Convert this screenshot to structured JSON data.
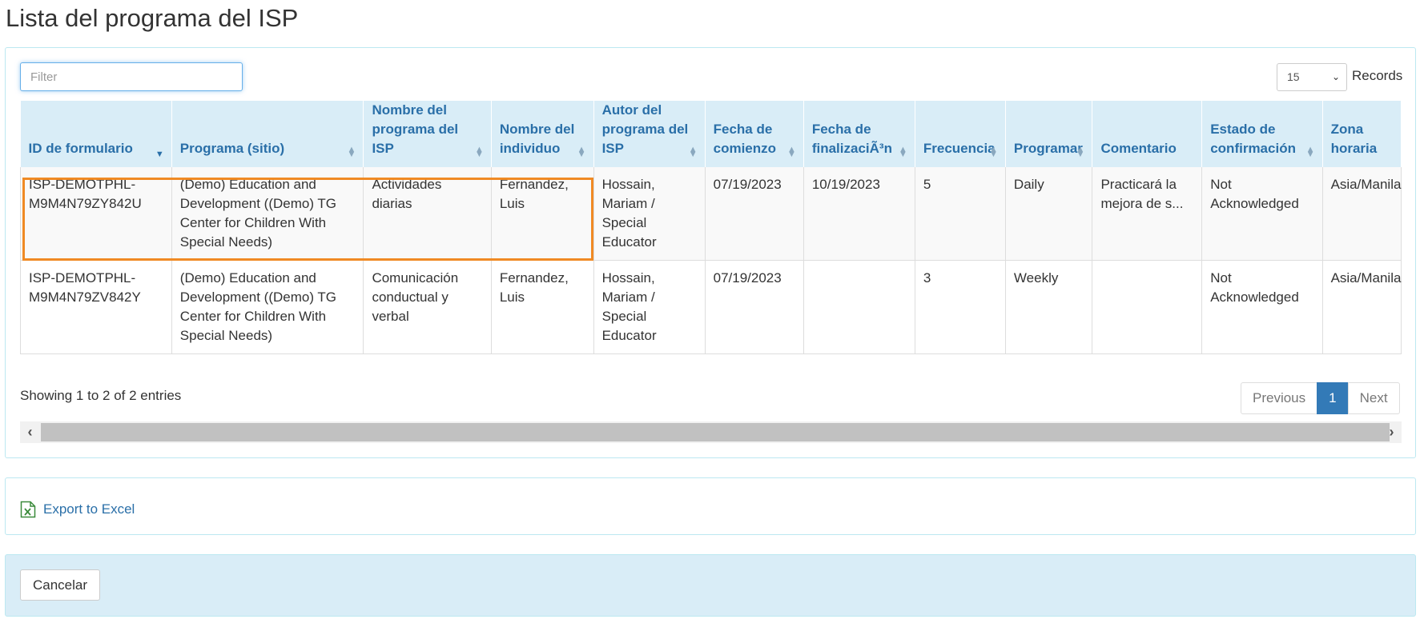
{
  "page": {
    "title": "Lista del programa del ISP"
  },
  "filter": {
    "placeholder": "Filter",
    "value": ""
  },
  "records": {
    "selected": "15",
    "label": "Records"
  },
  "table": {
    "columns": [
      "ID de formulario",
      "Programa (sitio)",
      "Nombre del programa del ISP",
      "Nombre del individuo",
      "Autor del programa del ISP",
      "Fecha de comienzo",
      "Fecha de finalizaciÃ³n",
      "Frecuencia",
      "Programar",
      "Comentario",
      "Estado de confirmación",
      "Zona horaria"
    ],
    "rows": [
      {
        "id": "ISP-DEMOTPHL-M9M4N79ZY842U",
        "program": "(Demo) Education and Development ((Demo) TG Center for Children With Special Needs)",
        "isp_name": "Actividades diarias",
        "individual": "Fernandez, Luis",
        "author": "Hossain, Mariam / Special Educator",
        "start": "07/19/2023",
        "end": "10/19/2023",
        "frequency": "5",
        "schedule": "Daily",
        "comment": "Practicará la mejora de s...",
        "status": "Not Acknowledged",
        "timezone": "Asia/Manila"
      },
      {
        "id": "ISP-DEMOTPHL-M9M4N79ZV842Y",
        "program": "(Demo) Education and Development ((Demo) TG Center for Children With Special Needs)",
        "isp_name": "Comunicación conductual y verbal",
        "individual": "Fernandez, Luis",
        "author": "Hossain, Mariam / Special Educator",
        "start": "07/19/2023",
        "end": "",
        "frequency": "3",
        "schedule": "Weekly",
        "comment": "",
        "status": "Not Acknowledged",
        "timezone": "Asia/Manila"
      }
    ],
    "info": "Showing 1 to 2 of 2 entries"
  },
  "pagination": {
    "previous": "Previous",
    "current": "1",
    "next": "Next"
  },
  "export": {
    "label": "Export to Excel",
    "icon": "excel-file-icon"
  },
  "actions": {
    "cancel": "Cancelar"
  },
  "colors": {
    "header_bg": "#d9edf7",
    "header_text": "#2a6fa8",
    "highlight": "#f08a24",
    "active_page": "#337ab7"
  }
}
